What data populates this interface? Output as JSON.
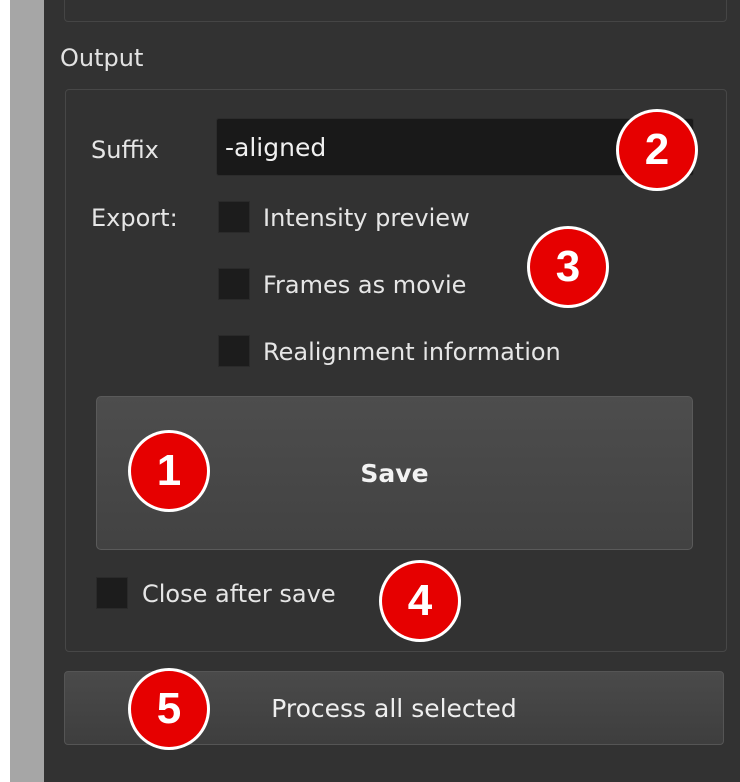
{
  "output": {
    "title": "Output",
    "suffix_label": "Suffix",
    "suffix_value": "-aligned",
    "export_label": "Export:",
    "export_options": [
      {
        "label": "Intensity preview",
        "checked": false
      },
      {
        "label": "Frames as movie",
        "checked": false
      },
      {
        "label": "Realignment information",
        "checked": false
      }
    ],
    "save_label": "Save",
    "close_after_save": {
      "label": "Close after save",
      "checked": false
    },
    "process_label": "Process all selected"
  },
  "badges": [
    "1",
    "2",
    "3",
    "4",
    "5"
  ],
  "colors": {
    "panel_bg": "#323232",
    "badge_red": "#e60000",
    "input_bg": "#191919",
    "side_strip": "#a6a6a6"
  }
}
